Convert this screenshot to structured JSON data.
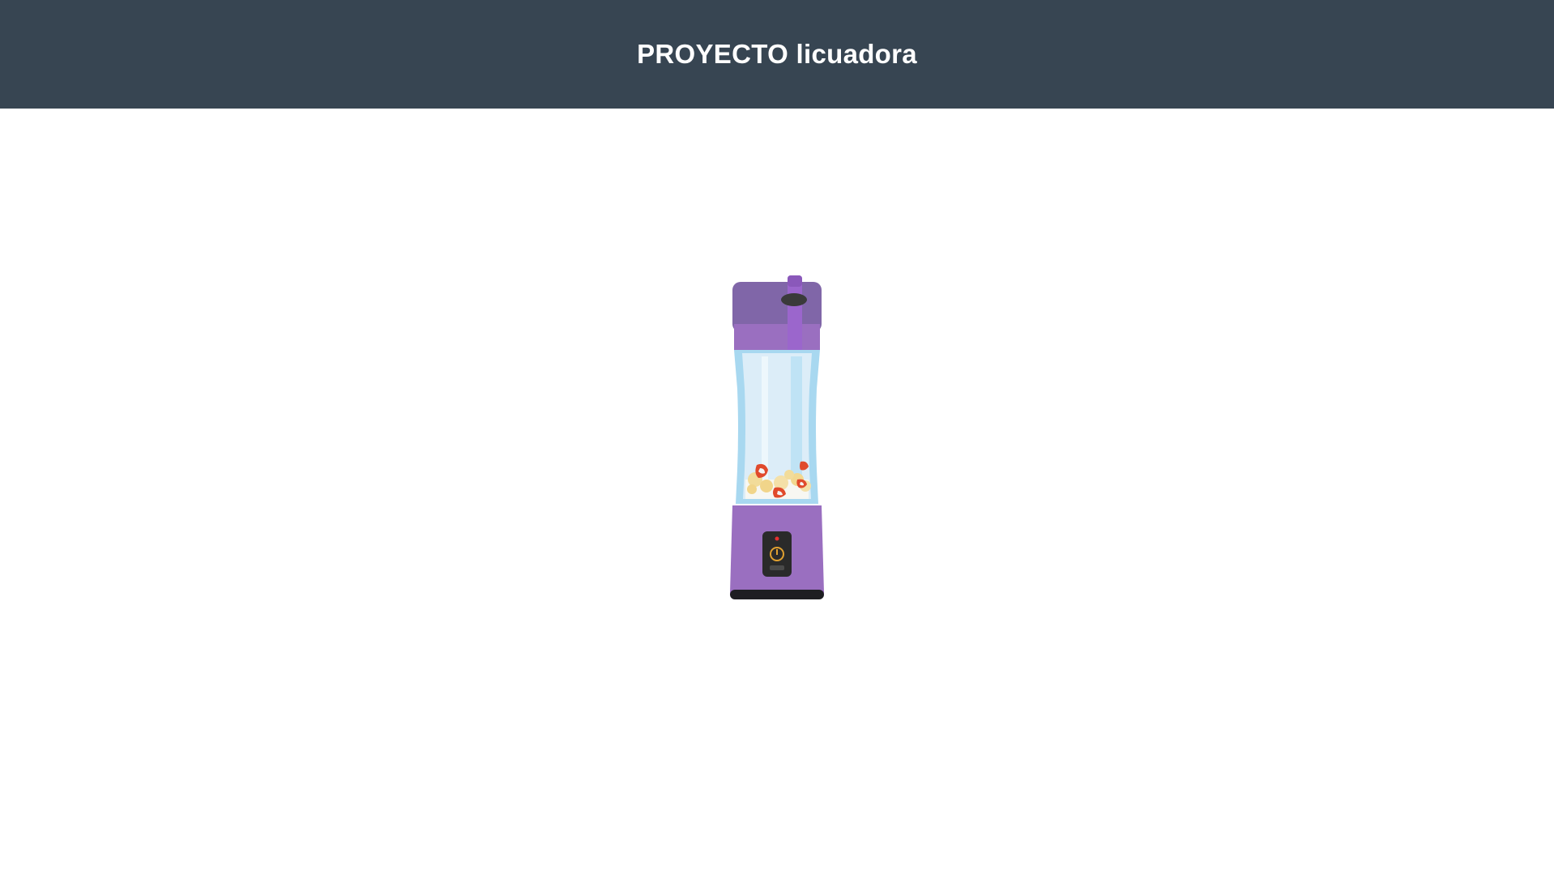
{
  "header": {
    "title": "PROYECTO licuadora"
  },
  "colors": {
    "header_bg": "#374552",
    "page_bg": "#ffffff",
    "blender_lid": "#8066a8",
    "blender_lid_band": "#9a6fc0",
    "blender_base": "#9a6fc0",
    "blender_glass": "#a8d8f0",
    "blender_glass_inner": "#dcedf8",
    "control_panel": "#2a2a2a",
    "power_icon": "#e0a030",
    "indicator_led": "#e53030",
    "base_foot": "#1e1e22"
  },
  "blender": {
    "state": "off",
    "icons": [
      "power-icon",
      "indicator-led"
    ]
  }
}
